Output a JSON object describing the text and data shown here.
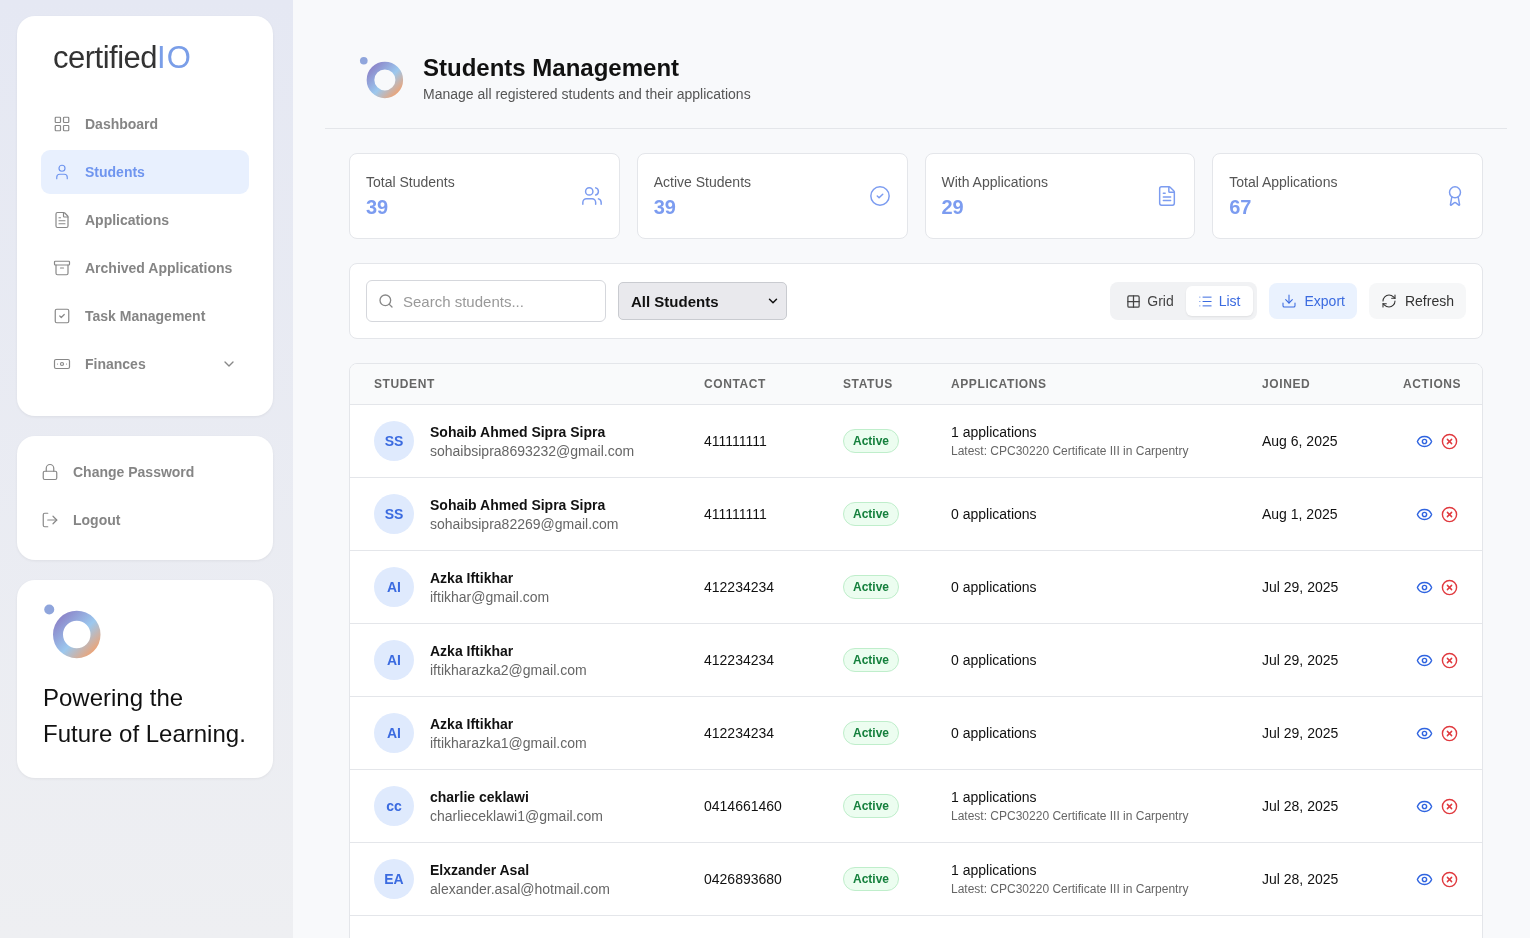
{
  "brand": {
    "name": "certified",
    "suffix": "IO"
  },
  "sidebar": {
    "items": [
      {
        "label": "Dashboard",
        "kind": "grid",
        "selected": false
      },
      {
        "label": "Students",
        "kind": "user",
        "selected": true
      },
      {
        "label": "Applications",
        "kind": "file",
        "selected": false
      },
      {
        "label": "Archived Applications",
        "kind": "archive",
        "selected": false
      },
      {
        "label": "Task Management",
        "kind": "check",
        "selected": false
      },
      {
        "label": "Finances",
        "kind": "money",
        "selected": false,
        "expandable": true
      }
    ],
    "account_items": [
      {
        "label": "Change Password",
        "kind": "lock"
      },
      {
        "label": "Logout",
        "kind": "logout"
      }
    ],
    "promo": {
      "text": "Powering the Future of Learning."
    }
  },
  "header": {
    "title": "Students Management",
    "subtitle": "Manage all registered students and their applications"
  },
  "stats": [
    {
      "label": "Total Students",
      "value": "39",
      "kind": "users"
    },
    {
      "label": "Active Students",
      "value": "39",
      "kind": "check-circle"
    },
    {
      "label": "With Applications",
      "value": "29",
      "kind": "file"
    },
    {
      "label": "Total Applications",
      "value": "67",
      "kind": "award"
    }
  ],
  "toolbar": {
    "search": {
      "placeholder": "Search students..."
    },
    "filter": {
      "value": "All Students"
    },
    "views": [
      {
        "label": "Grid",
        "kind": "grid",
        "selected": false
      },
      {
        "label": "List",
        "kind": "list",
        "selected": true
      }
    ],
    "buttons": [
      {
        "label": "Export",
        "kind": "download"
      },
      {
        "label": "Refresh",
        "kind": "refresh"
      }
    ]
  },
  "table": {
    "columns": [
      "STUDENT",
      "CONTACT",
      "STATUS",
      "APPLICATIONS",
      "JOINED",
      "ACTIONS"
    ],
    "rows": [
      {
        "initials": "SS",
        "name": "Sohaib Ahmed Sipra Sipra",
        "email": "sohaibsipra8693232@gmail.com",
        "contact": "411111111",
        "status": "Active",
        "applications": "1 applications",
        "latest": "Latest: CPC30220 Certificate III in Carpentry",
        "joined": "Aug 6, 2025"
      },
      {
        "initials": "SS",
        "name": "Sohaib Ahmed Sipra Sipra",
        "email": "sohaibsipra82269@gmail.com",
        "contact": "411111111",
        "status": "Active",
        "applications": "0 applications",
        "joined": "Aug 1, 2025"
      },
      {
        "initials": "AI",
        "name": "Azka Iftikhar",
        "email": "iftikhar@gmail.com",
        "contact": "412234234",
        "status": "Active",
        "applications": "0 applications",
        "joined": "Jul 29, 2025"
      },
      {
        "initials": "AI",
        "name": "Azka Iftikhar",
        "email": "iftikharazka2@gmail.com",
        "contact": "412234234",
        "status": "Active",
        "applications": "0 applications",
        "joined": "Jul 29, 2025"
      },
      {
        "initials": "AI",
        "name": "Azka Iftikhar",
        "email": "iftikharazka1@gmail.com",
        "contact": "412234234",
        "status": "Active",
        "applications": "0 applications",
        "joined": "Jul 29, 2025"
      },
      {
        "initials": "cc",
        "name": "charlie ceklawi",
        "email": "charlieceklawi1@gmail.com",
        "contact": "0414661460",
        "status": "Active",
        "applications": "1 applications",
        "latest": "Latest: CPC30220 Certificate III in Carpentry",
        "joined": "Jul 28, 2025"
      },
      {
        "initials": "EA",
        "name": "Elxzander Asal",
        "email": "alexander.asal@hotmail.com",
        "contact": "0426893680",
        "status": "Active",
        "applications": "1 applications",
        "latest": "Latest: CPC30220 Certificate III in Carpentry",
        "joined": "Jul 28, 2025"
      }
    ]
  }
}
